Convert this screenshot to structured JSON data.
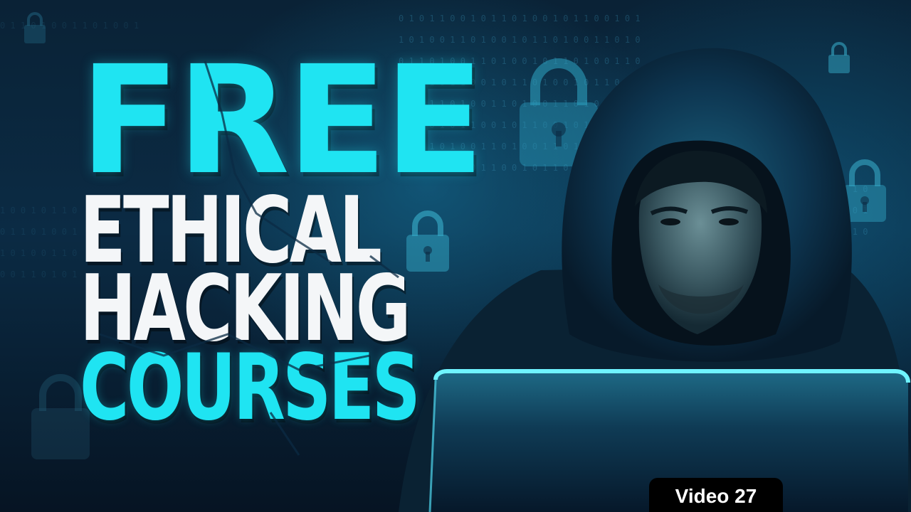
{
  "headline": {
    "line1": "FREE",
    "line2": "ETHICAL",
    "line3": "HACKING",
    "line4": "COURSES"
  },
  "badge": {
    "label": "Video 27"
  },
  "colors": {
    "accent": "#1fe4f2",
    "headline_white": "#f4f6f8",
    "background": "#0b2b44",
    "badge_bg": "#000000"
  },
  "icons": [
    "padlock-icon",
    "laptop-icon"
  ]
}
